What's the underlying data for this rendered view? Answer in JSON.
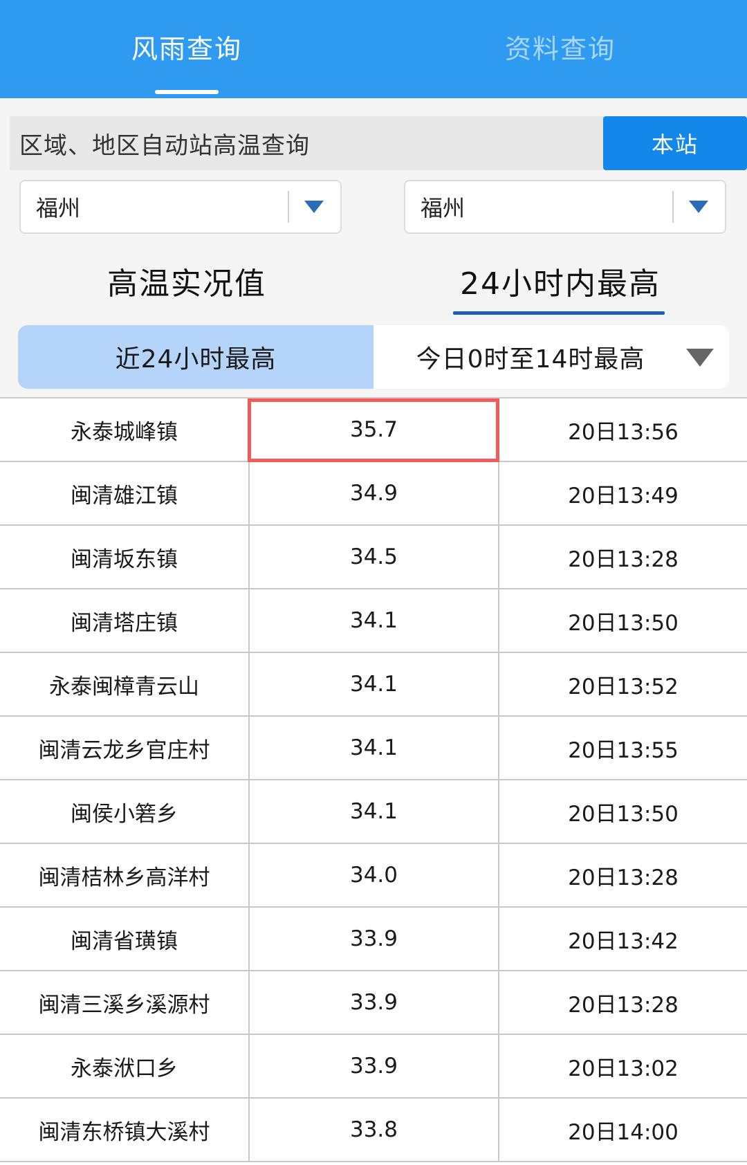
{
  "header": {
    "tabs": [
      {
        "label": "风雨查询"
      },
      {
        "label": "资料查询"
      }
    ]
  },
  "search": {
    "label": "区域、地区自动站高温查询",
    "station_button": "本站"
  },
  "selects": [
    {
      "value": "福州"
    },
    {
      "value": "福州"
    }
  ],
  "mode_tabs": [
    {
      "label": "高温实况值"
    },
    {
      "label": "24小时内最高"
    }
  ],
  "segment": {
    "option_a": "近24小时最高",
    "option_b": "今日0时至14时最高"
  },
  "colors": {
    "header_bg": "#2f9bf0",
    "accent": "#1387ea",
    "highlight_border": "#f25a5a"
  },
  "table": {
    "rows": [
      {
        "station": "永泰城峰镇",
        "temp": "35.7",
        "time": "20日13:56"
      },
      {
        "station": "闽清雄江镇",
        "temp": "34.9",
        "time": "20日13:49"
      },
      {
        "station": "闽清坂东镇",
        "temp": "34.5",
        "time": "20日13:28"
      },
      {
        "station": "闽清塔庄镇",
        "temp": "34.1",
        "time": "20日13:50"
      },
      {
        "station": "永泰闽樟青云山",
        "temp": "34.1",
        "time": "20日13:52"
      },
      {
        "station": "闽清云龙乡官庄村",
        "temp": "34.1",
        "time": "20日13:55"
      },
      {
        "station": "闽侯小箬乡",
        "temp": "34.1",
        "time": "20日13:50"
      },
      {
        "station": "闽清桔林乡高洋村",
        "temp": "34.0",
        "time": "20日13:28"
      },
      {
        "station": "闽清省璜镇",
        "temp": "33.9",
        "time": "20日13:42"
      },
      {
        "station": "闽清三溪乡溪源村",
        "temp": "33.9",
        "time": "20日13:28"
      },
      {
        "station": "永泰洑口乡",
        "temp": "33.9",
        "time": "20日13:02"
      },
      {
        "station": "闽清东桥镇大溪村",
        "temp": "33.8",
        "time": "20日14:00"
      }
    ]
  }
}
